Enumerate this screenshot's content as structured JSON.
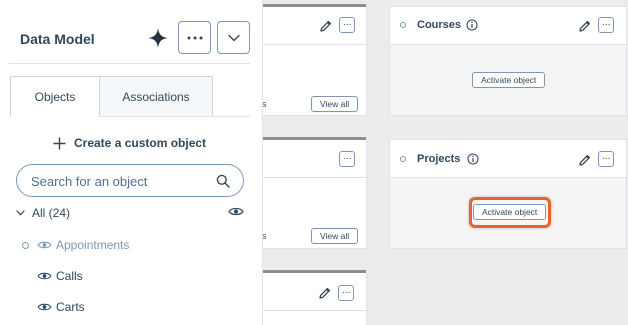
{
  "panel": {
    "title": "Data Model",
    "tabs": [
      {
        "label": "Objects",
        "active": true
      },
      {
        "label": "Associations",
        "active": false
      }
    ],
    "create_label": "Create a custom object",
    "search_placeholder": "Search for an object",
    "tree": {
      "all_label": "All (24)",
      "items": [
        {
          "label": "Appointments",
          "active": false
        },
        {
          "label": "Calls",
          "active": true
        },
        {
          "label": "Carts",
          "active": true
        }
      ]
    }
  },
  "cards": {
    "left_top": {
      "view_all": "View all",
      "truncated": "s"
    },
    "left_mid": {
      "view_all": "View all",
      "truncated": "s"
    },
    "courses": {
      "title": "Courses",
      "button": "Activate object"
    },
    "projects": {
      "title": "Projects",
      "button": "Activate object",
      "highlighted": true
    }
  },
  "colors": {
    "highlight": "#ea6226",
    "text": "#33475b",
    "border": "#7c98b6"
  },
  "icons": [
    "sparkle-icon",
    "more-icon",
    "chevron-down-icon",
    "plus-icon",
    "search-icon",
    "eye-icon",
    "pencil-icon",
    "info-icon"
  ]
}
